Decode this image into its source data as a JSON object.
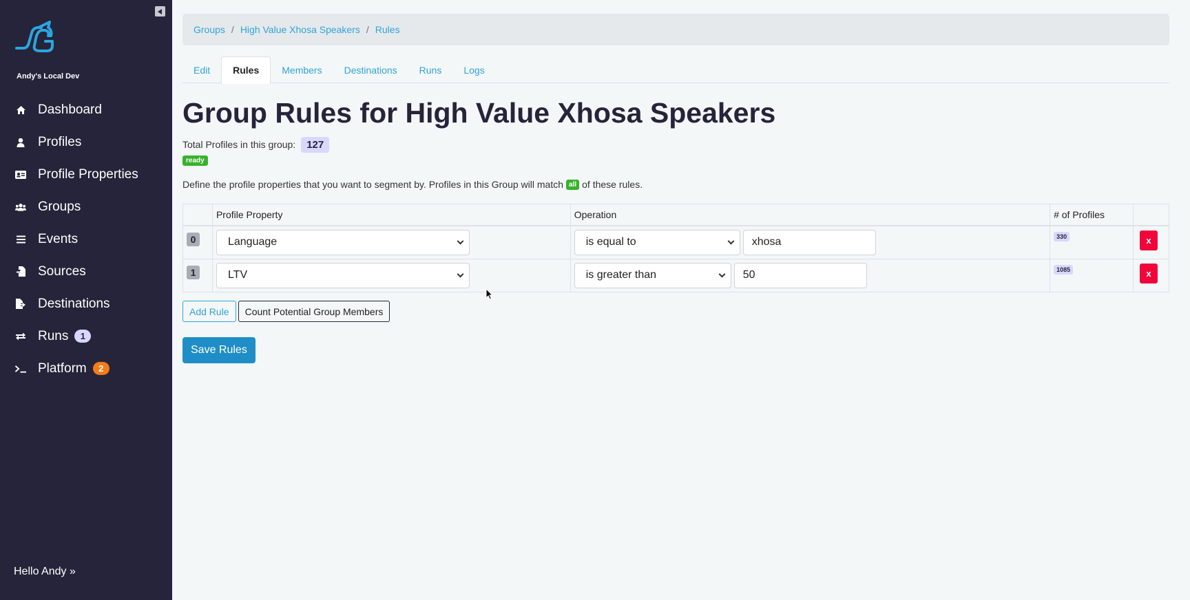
{
  "sidebar": {
    "workspace_name": "Andy's Local Dev",
    "items": [
      {
        "label": "Dashboard",
        "icon": "home-icon"
      },
      {
        "label": "Profiles",
        "icon": "user-icon"
      },
      {
        "label": "Profile Properties",
        "icon": "id-card-icon"
      },
      {
        "label": "Groups",
        "icon": "users-icon"
      },
      {
        "label": "Events",
        "icon": "list-icon"
      },
      {
        "label": "Sources",
        "icon": "file-import-icon"
      },
      {
        "label": "Destinations",
        "icon": "file-export-icon"
      },
      {
        "label": "Runs",
        "icon": "exchange-icon",
        "badge": "1"
      },
      {
        "label": "Platform",
        "icon": "terminal-icon",
        "badge": "2"
      }
    ],
    "greeting": "Hello Andy »"
  },
  "breadcrumb": {
    "items": [
      "Groups",
      "High Value Xhosa Speakers",
      "Rules"
    ],
    "separator": "/"
  },
  "tabs": {
    "items": [
      "Edit",
      "Rules",
      "Members",
      "Destinations",
      "Runs",
      "Logs"
    ],
    "active": "Rules"
  },
  "page": {
    "title": "Group Rules for High Value Xhosa Speakers",
    "total_label": "Total Profiles in this group:",
    "total_count": "127",
    "state": "ready",
    "define_text_before": "Define the profile properties that you want to segment by. Profiles in this Group will match",
    "match_mode": "all",
    "define_text_after": "of these rules."
  },
  "table": {
    "headers": [
      "",
      "Profile Property",
      "Operation",
      "# of Profiles",
      ""
    ],
    "rows": [
      {
        "index": "0",
        "property": "Language",
        "operation": "is equal to",
        "value": "xhosa",
        "profiles": "330",
        "delete_label": "x"
      },
      {
        "index": "1",
        "property": "LTV",
        "operation": "is greater than",
        "value": "50",
        "profiles": "1085",
        "delete_label": "x"
      }
    ]
  },
  "actions": {
    "add_rule": "Add Rule",
    "count_members": "Count Potential Group Members",
    "save": "Save Rules"
  },
  "colors": {
    "sidebar_bg": "#26243a",
    "link": "#2fa4d7",
    "success": "#38b12c",
    "danger": "#f1063c",
    "primary_button": "#1f8ec6",
    "badge_bg": "#d8d7ff",
    "warning_badge": "#f57c16"
  }
}
